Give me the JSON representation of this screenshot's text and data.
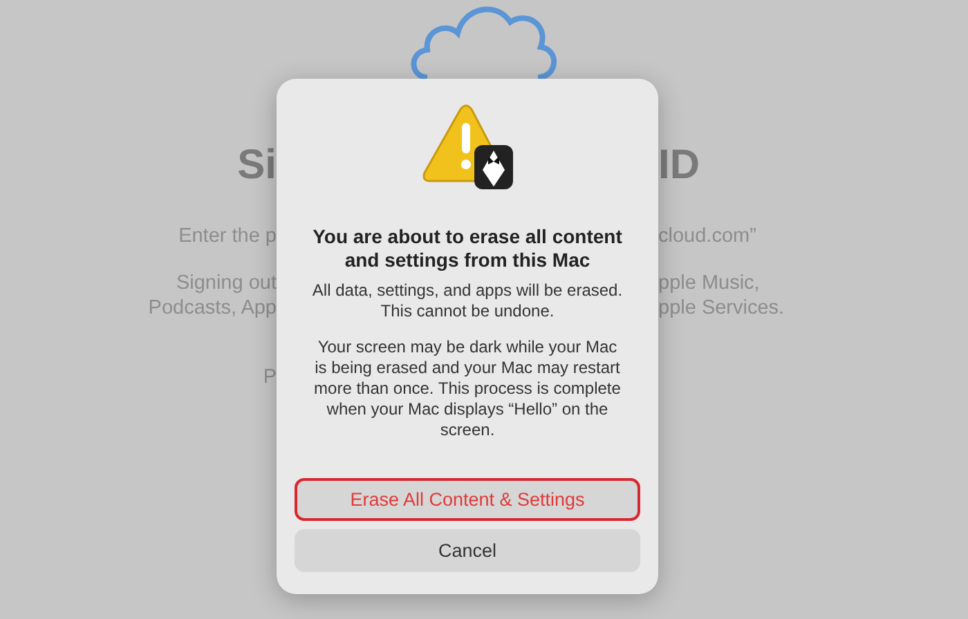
{
  "background": {
    "title_left": "Si",
    "title_right": "ID",
    "lines": [
      {
        "left": "Enter the p",
        "right": "cloud.com”"
      },
      {
        "left": "Signing out",
        "right": "pple Music,"
      },
      {
        "left": "Podcasts, App",
        "right": "pple Services."
      }
    ],
    "field_left": "P"
  },
  "dialog": {
    "title": "You are about to erase all content and settings from this Mac",
    "paragraphs": [
      "All data, settings, and apps will be erased. This cannot be undone.",
      "Your screen may be dark while your Mac is being erased and your Mac may restart more than once. This process is complete when your Mac displays “Hello” on the screen."
    ],
    "buttons": [
      {
        "label": "Erase All Content & Settings",
        "kind": "destructive",
        "focused": true
      },
      {
        "label": "Cancel",
        "kind": "normal",
        "focused": false
      }
    ]
  }
}
